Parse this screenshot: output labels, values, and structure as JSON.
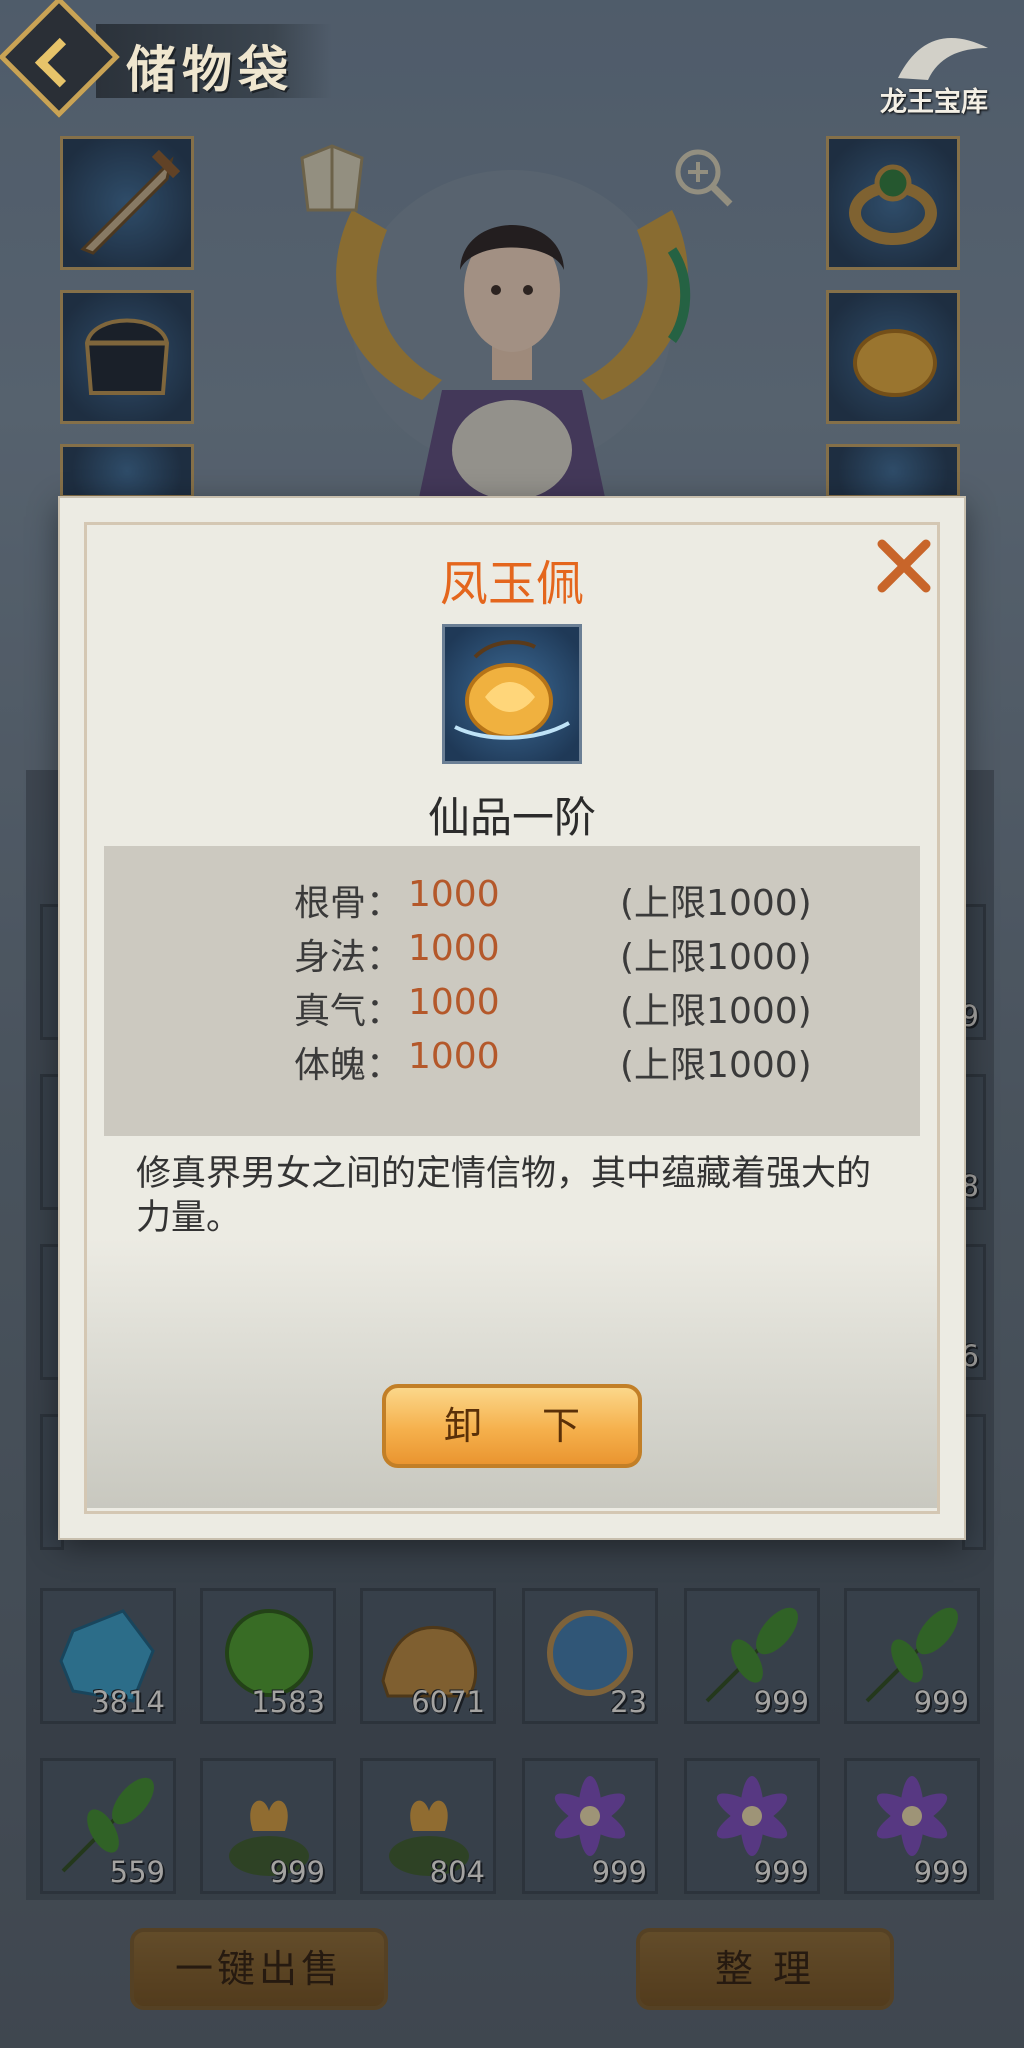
{
  "header": {
    "title": "储物袋",
    "logo_text": "龙王宝库"
  },
  "modal": {
    "item_name": "凤玉佩",
    "grade": "仙品一阶",
    "stats": [
      {
        "name": "根骨：",
        "value": "1000",
        "cap": "(上限1000)"
      },
      {
        "name": "身法：",
        "value": "1000",
        "cap": "(上限1000)"
      },
      {
        "name": "真气：",
        "value": "1000",
        "cap": "(上限1000)"
      },
      {
        "name": "体魄：",
        "value": "1000",
        "cap": "(上限1000)"
      }
    ],
    "description": "修真界男女之间的定情信物，其中蕴藏着强大的力量。",
    "unequip_label": "卸 下",
    "colors": {
      "title": "#e4661d",
      "value": "#b4582a"
    }
  },
  "inventory": {
    "row_partial": [
      "9",
      "8",
      "6"
    ],
    "row_a": [
      "3814",
      "1583",
      "6071",
      "23",
      "999",
      "999"
    ],
    "row_b": [
      "559",
      "999",
      "804",
      "999",
      "999",
      "999"
    ]
  },
  "footer": {
    "sell_all_label": "一键出售",
    "sort_label": "整 理"
  },
  "icons": [
    "back-arrow-icon",
    "close-icon",
    "zoom-in-icon",
    "pendant-icon",
    "sword-icon",
    "helmet-icon",
    "ring-icon"
  ]
}
